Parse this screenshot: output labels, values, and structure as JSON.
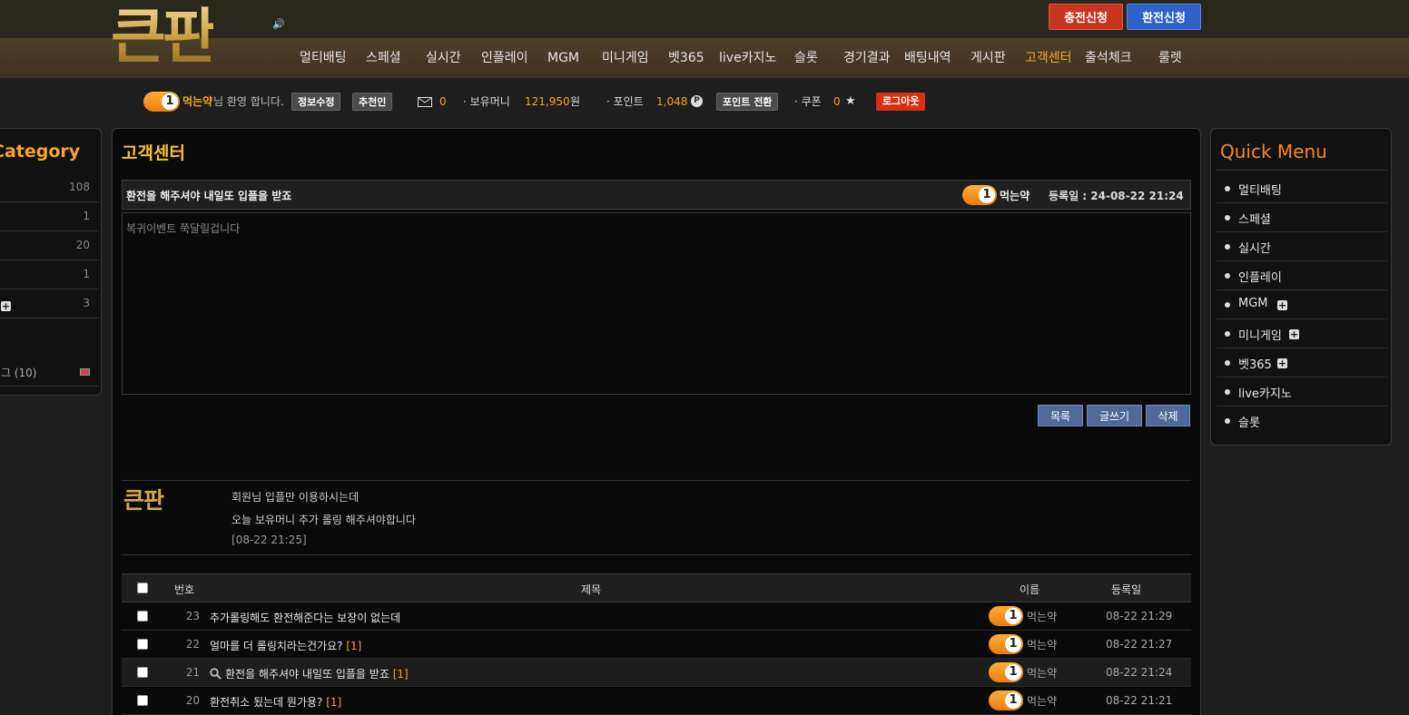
{
  "brand": {
    "logo": "큰판"
  },
  "header": {
    "charge_label": "충전신청",
    "exchange_label": "환전신청"
  },
  "nav": {
    "items": [
      "멀티배팅",
      "스페셜",
      "실시간",
      "인플레이",
      "MGM",
      "미니게임",
      "벳365",
      "live카지노",
      "슬롯",
      "경기결과",
      "배팅내역",
      "게시판",
      "고객센터",
      "출석체크",
      "룰렛"
    ],
    "active": "고객센터"
  },
  "userbar": {
    "level": "1",
    "username": "먹는약",
    "welcome": "님 환영 합니다.",
    "edit_info": "정보수정",
    "referral": "추천인",
    "mail_count": "0",
    "money_label": "· 보유머니",
    "money_value": "121,950",
    "money_unit": "원",
    "point_label": "· 포인트",
    "point_value": "1,048",
    "point_icon": "P",
    "point_convert": "포인트 전환",
    "coupon_label": "· 쿠폰",
    "coupon_value": "0",
    "logout": "로그아웃"
  },
  "category": {
    "title": "Category",
    "rows": [
      {
        "count": "108"
      },
      {
        "count": "1"
      },
      {
        "count": "20"
      },
      {
        "count": "1"
      },
      {
        "count": "3"
      },
      {
        "count": ""
      },
      {
        "label": "그 (10)"
      }
    ]
  },
  "board": {
    "title": "고객센터",
    "post": {
      "subject": "환전을 해주셔야 내일또 입플을 받죠",
      "author": "먹는약",
      "level": "1",
      "date_label": "등록일 : 24-08-22 21:24",
      "body": "복귀이벤트 쭉달릴겁니다"
    },
    "buttons": {
      "list": "목록",
      "write": "글쓰기",
      "delete": "삭제"
    },
    "reply": {
      "author_logo": "큰판",
      "line1": "회원님 입플만 이용하시는데",
      "line2": "오늘 보유머니 추가 롤링 해주셔야합니다",
      "date": "[08-22 21:25]"
    },
    "list": {
      "headers": {
        "num": "번호",
        "subject": "제목",
        "name": "이름",
        "date": "등록일"
      },
      "rows": [
        {
          "num": "23",
          "subject": "추가롤링해도 환전해준다는 보장이 없는데",
          "comments": "",
          "name": "먹는약",
          "level": "1",
          "date": "08-22 21:29",
          "current": false
        },
        {
          "num": "22",
          "subject": "얼마를 더 롤링치라는건가요?",
          "comments": "[1]",
          "name": "먹는약",
          "level": "1",
          "date": "08-22 21:27",
          "current": false
        },
        {
          "num": "21",
          "subject": "환전을 해주셔야 내일또 입플을 받죠",
          "comments": "[1]",
          "name": "먹는약",
          "level": "1",
          "date": "08-22 21:24",
          "current": true
        },
        {
          "num": "20",
          "subject": "환전취소 됬는데 뭔가용?",
          "comments": "[1]",
          "name": "먹는약",
          "level": "1",
          "date": "08-22 21:21",
          "current": false
        }
      ]
    }
  },
  "quick_menu": {
    "title": "Quick Menu",
    "items": [
      {
        "label": "멀티배팅",
        "plus": false
      },
      {
        "label": "스페셜",
        "plus": false
      },
      {
        "label": "실시간",
        "plus": false
      },
      {
        "label": "인플레이",
        "plus": false
      },
      {
        "label": "MGM",
        "plus": true
      },
      {
        "label": "미니게임",
        "plus": true
      },
      {
        "label": "벳365",
        "plus": true
      },
      {
        "label": "live카지노",
        "plus": false
      },
      {
        "label": "슬롯",
        "plus": false
      }
    ]
  },
  "colors": {
    "accent": "#f6a623",
    "charge": "#c8351f",
    "exchange": "#2f62c9",
    "button": "#4f6a9a"
  }
}
